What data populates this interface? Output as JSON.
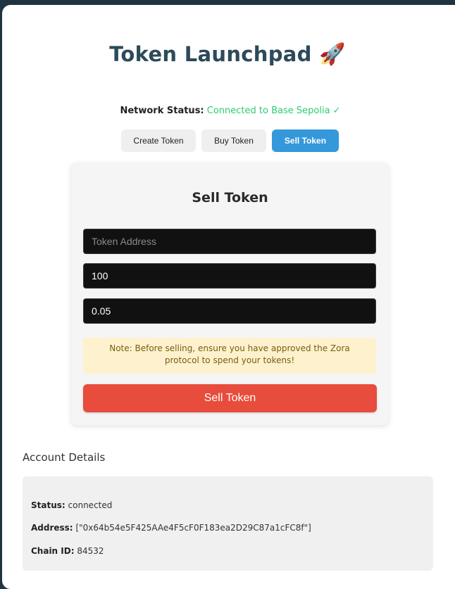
{
  "app": {
    "title": "Token Launchpad",
    "title_icon": "🚀"
  },
  "network": {
    "label": "Network Status:",
    "value": "Connected to Base Sepolia ✓",
    "value_color": "#2ecc71"
  },
  "tabs": [
    {
      "label": "Create Token",
      "active": false
    },
    {
      "label": "Buy Token",
      "active": false
    },
    {
      "label": "Sell Token",
      "active": true
    }
  ],
  "form": {
    "title": "Sell Token",
    "token_address": {
      "placeholder": "Token Address",
      "value": ""
    },
    "amount": {
      "value": "100"
    },
    "min_eth": {
      "value": "0.05"
    },
    "note": "Note: Before selling, ensure you have approved the Zora protocol to spend your tokens!",
    "submit_label": "Sell Token",
    "submit_color": "#e74c3c"
  },
  "account": {
    "heading": "Account Details",
    "status_label": "Status:",
    "status_value": "connected",
    "address_label": "Address:",
    "address_value": "[\"0x64b54e5F425AAe4F5cF0F183ea2D29C87a1cFC8f\"]",
    "chain_label": "Chain ID:",
    "chain_value": "84532"
  },
  "colors": {
    "accent": "#3498db",
    "title": "#2c4a5a",
    "background": "#1f3340"
  }
}
